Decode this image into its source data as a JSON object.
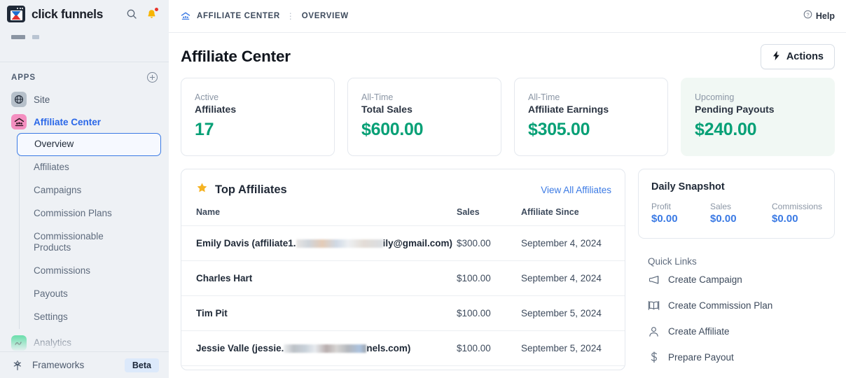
{
  "sidebar": {
    "brand": "click funnels",
    "brand_icons": {
      "search": "search-icon",
      "notifications": "bell-icon"
    },
    "apps_section_label": "APPS",
    "add_app_icon": "plus-circle-icon",
    "apps": [
      {
        "label": "Site",
        "icon": "globe-icon",
        "active": false
      },
      {
        "label": "Affiliate Center",
        "icon": "affiliate-house-icon",
        "active": true
      },
      {
        "label": "Analytics",
        "icon": "chart-line-icon",
        "active": false
      }
    ],
    "subnav": [
      {
        "label": "Overview",
        "selected": true
      },
      {
        "label": "Affiliates",
        "selected": false
      },
      {
        "label": "Campaigns",
        "selected": false
      },
      {
        "label": "Commission Plans",
        "selected": false
      },
      {
        "label": "Commissionable Products",
        "selected": false
      },
      {
        "label": "Commissions",
        "selected": false
      },
      {
        "label": "Payouts",
        "selected": false
      },
      {
        "label": "Settings",
        "selected": false
      }
    ],
    "footer": {
      "label": "Frameworks",
      "badge": "Beta",
      "icon": "frameworks-gear-icon"
    }
  },
  "topbar": {
    "breadcrumb_icon": "affiliate-house-icon",
    "breadcrumb_root": "AFFILIATE CENTER",
    "breadcrumb_separator": "⋮",
    "breadcrumb_current": "OVERVIEW",
    "help_label": "Help",
    "help_icon": "question-circle-icon"
  },
  "page": {
    "title": "Affiliate Center",
    "actions_label": "Actions",
    "actions_icon": "lightning-bolt-icon"
  },
  "stats": [
    {
      "sub": "Active",
      "label": "Affiliates",
      "value": "17",
      "tinted": false
    },
    {
      "sub": "All-Time",
      "label": "Total Sales",
      "value": "$600.00",
      "tinted": false
    },
    {
      "sub": "All-Time",
      "label": "Affiliate Earnings",
      "value": "$305.00",
      "tinted": false
    },
    {
      "sub": "Upcoming",
      "label": "Pending Payouts",
      "value": "$240.00",
      "tinted": true
    }
  ],
  "top_affiliates": {
    "icon": "star-icon",
    "title": "Top Affiliates",
    "view_all_label": "View All Affiliates",
    "columns": [
      "Name",
      "Sales",
      "Affiliate Since"
    ],
    "rows": [
      {
        "name_prefix": "Emily Davis (affiliate1.",
        "name_redacted": true,
        "name_suffix": "ily@gmail.com)",
        "sales": "$300.00",
        "since": "September 4, 2024"
      },
      {
        "name_prefix": "Charles Hart",
        "name_redacted": false,
        "name_suffix": "",
        "sales": "$100.00",
        "since": "September 4, 2024"
      },
      {
        "name_prefix": "Tim Pit",
        "name_redacted": false,
        "name_suffix": "",
        "sales": "$100.00",
        "since": "September 5, 2024"
      },
      {
        "name_prefix": "Jessie Valle (jessie.",
        "name_redacted": true,
        "name_suffix": "nels.com)",
        "sales": "$100.00",
        "since": "September 5, 2024"
      }
    ]
  },
  "daily_snapshot": {
    "title": "Daily Snapshot",
    "metrics": [
      {
        "key": "Profit",
        "value": "$0.00"
      },
      {
        "key": "Sales",
        "value": "$0.00"
      },
      {
        "key": "Commissions",
        "value": "$0.00"
      }
    ]
  },
  "quick_links": {
    "title": "Quick Links",
    "items": [
      {
        "label": "Create Campaign",
        "icon": "megaphone-icon"
      },
      {
        "label": "Create Commission Plan",
        "icon": "book-icon"
      },
      {
        "label": "Create Affiliate",
        "icon": "person-icon"
      },
      {
        "label": "Prepare Payout",
        "icon": "dollar-sign-icon"
      }
    ]
  },
  "colors": {
    "green": "#07a076",
    "blue": "#3b7ae4",
    "tinted_card_bg": "#f1f8f4",
    "sidebar_bg": "#eef1f5",
    "star_yellow": "#f5b323"
  }
}
